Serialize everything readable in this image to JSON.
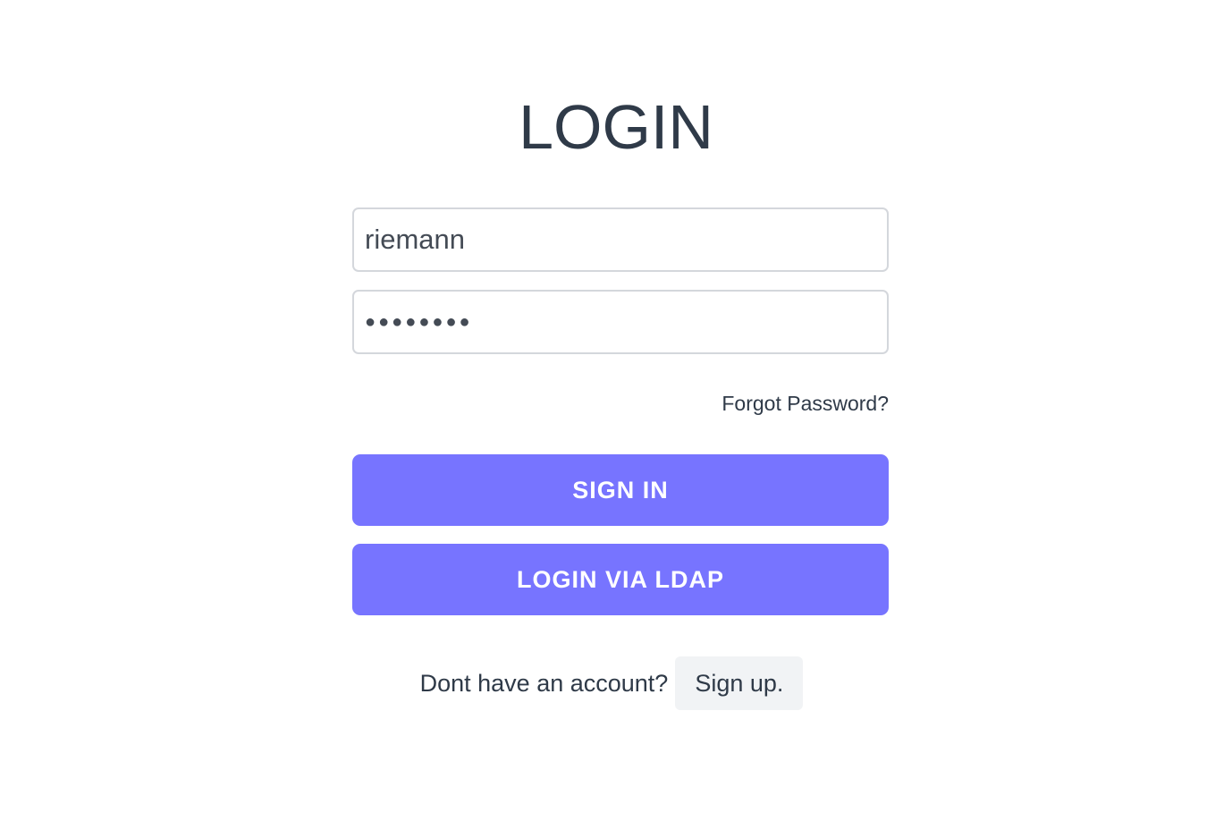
{
  "page": {
    "title": "LOGIN"
  },
  "form": {
    "username_value": "riemann",
    "password_masked": "●●●●●●●●",
    "forgot_password": "Forgot Password?",
    "sign_in_label": "SIGN IN",
    "ldap_label": "LOGIN VIA LDAP"
  },
  "signup": {
    "prompt": "Dont have an account?",
    "link": "Sign up."
  },
  "colors": {
    "accent": "#7774ff",
    "text": "#2f3a48",
    "input_border": "#d4d7dc",
    "signup_bg": "#f1f3f5"
  }
}
